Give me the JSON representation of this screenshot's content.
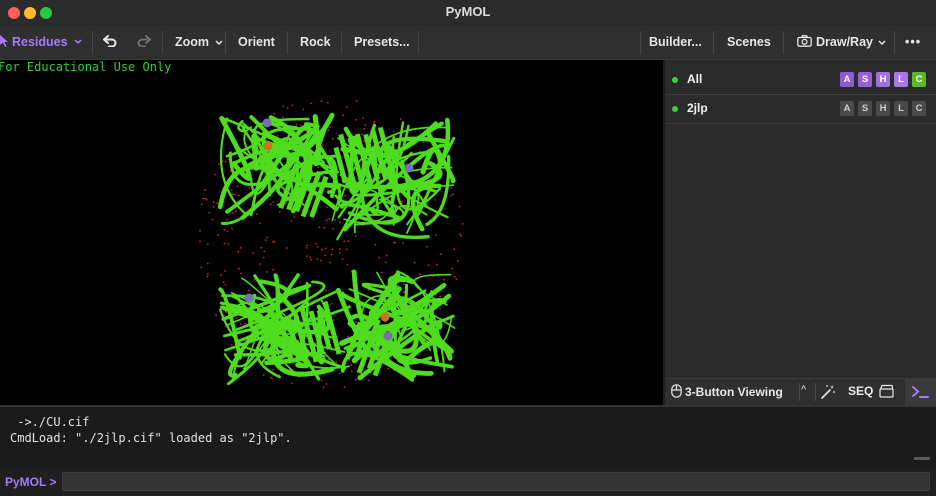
{
  "window": {
    "title": "PyMOL"
  },
  "toolbar": {
    "residues": "Residues",
    "zoom": "Zoom",
    "orient": "Orient",
    "rock": "Rock",
    "presets": "Presets...",
    "builder": "Builder...",
    "scenes": "Scenes",
    "draw_ray": "Draw/Ray",
    "more": "•••"
  },
  "viewport": {
    "watermark": "For Educational Use Only"
  },
  "objects": [
    {
      "name": "All",
      "buttons": [
        "A",
        "S",
        "H",
        "L",
        "C"
      ],
      "active": true
    },
    {
      "name": "2jlp",
      "buttons": [
        "A",
        "S",
        "H",
        "L",
        "C"
      ],
      "active": false
    }
  ],
  "panel_footer": {
    "mouse_mode": "3-Button Viewing",
    "seq": "SEQ"
  },
  "console": {
    "lines": [
      " ->./CU.cif",
      "CmdLoad: \"./2jlp.cif\" loaded as \"2jlp\"."
    ]
  },
  "command": {
    "prompt": "PyMOL >",
    "value": ""
  },
  "colors": {
    "accent_purple": "#9b6bf0",
    "cartoon_green": "#4fdc1e",
    "A": "#8e5ad8",
    "S": "#9560d8",
    "H": "#a070e0",
    "L": "#a878e6",
    "C": "#5cb82a"
  }
}
